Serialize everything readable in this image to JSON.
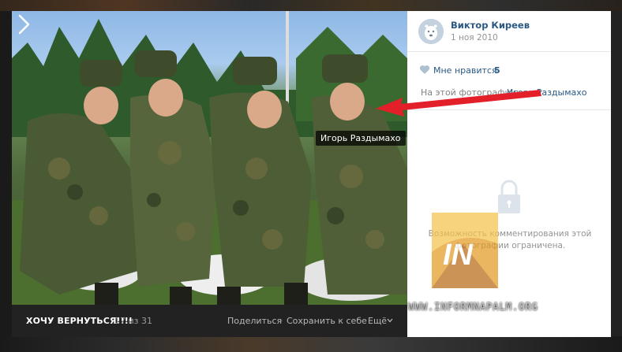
{
  "photo": {
    "tag_name": "Игорь Раздымахо"
  },
  "bottom_bar": {
    "title": "ХОЧУ ВЕРНУТЬСЯ!!!!",
    "counter": "17 из 31",
    "share_label": "Поделиться",
    "save_label": "Сохранить к себе",
    "separator": "·",
    "more_label": "Ещё"
  },
  "panel": {
    "author_name": "Виктор Киреев",
    "date": "1 ноя 2010",
    "like_label": "Мне нравится",
    "like_count": "5",
    "on_photo_label": "На этой фотографии:",
    "on_photo_person": "Игорь Раздымахо",
    "comments_closed_text": "Возможность комментирования этой фотографии ограничена."
  },
  "watermark": {
    "logo_text": "IN",
    "site": "WWW.INFORMNAPALM.ORG"
  },
  "colors": {
    "link": "#2a5885",
    "muted": "#939393",
    "arrow": "#e3202a",
    "bar_bg": "#222222"
  },
  "icons": [
    "avatar-dog-icon",
    "heart-icon",
    "lock-icon",
    "chevron-right-icon",
    "chevron-down-icon"
  ]
}
